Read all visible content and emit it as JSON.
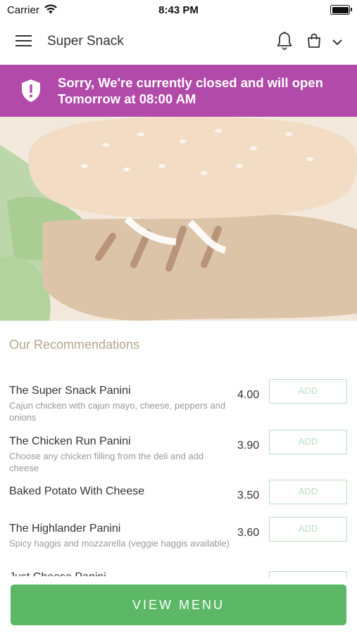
{
  "status_bar": {
    "carrier": "Carrier",
    "time": "8:43 PM"
  },
  "header": {
    "title": "Super Snack"
  },
  "banner": {
    "line1": "Sorry, We're currently closed and will open",
    "line2": "Tomorrow at 08:00 AM",
    "color": "#b24aaa"
  },
  "recommendations": {
    "title": "Our Recommendations",
    "items": [
      {
        "name": "The Super Snack Panini",
        "desc": "Cajun chicken with cajun mayo, cheese, peppers and onions",
        "price": "4.00",
        "add_label": "ADD"
      },
      {
        "name": "The Chicken Run Panini",
        "desc": "Choose any chicken filling from the deli and add cheese",
        "price": "3.90",
        "add_label": "ADD"
      },
      {
        "name": "Baked Potato With Cheese",
        "desc": "",
        "price": "3.50",
        "add_label": "ADD"
      },
      {
        "name": "The Highlander Panini",
        "desc": "Spicy haggis and mozzarella (veggie haggis available)",
        "price": "3.60",
        "add_label": "ADD"
      }
    ],
    "partial_item": "Just Cheese Panini"
  },
  "footer": {
    "view_menu_label": "VIEW MENU",
    "color": "#5cb866"
  },
  "icons": [
    "wifi-icon",
    "battery-icon",
    "hamburger-menu-icon",
    "bell-icon",
    "shopping-bag-icon",
    "chevron-down-icon",
    "shield-icon"
  ]
}
